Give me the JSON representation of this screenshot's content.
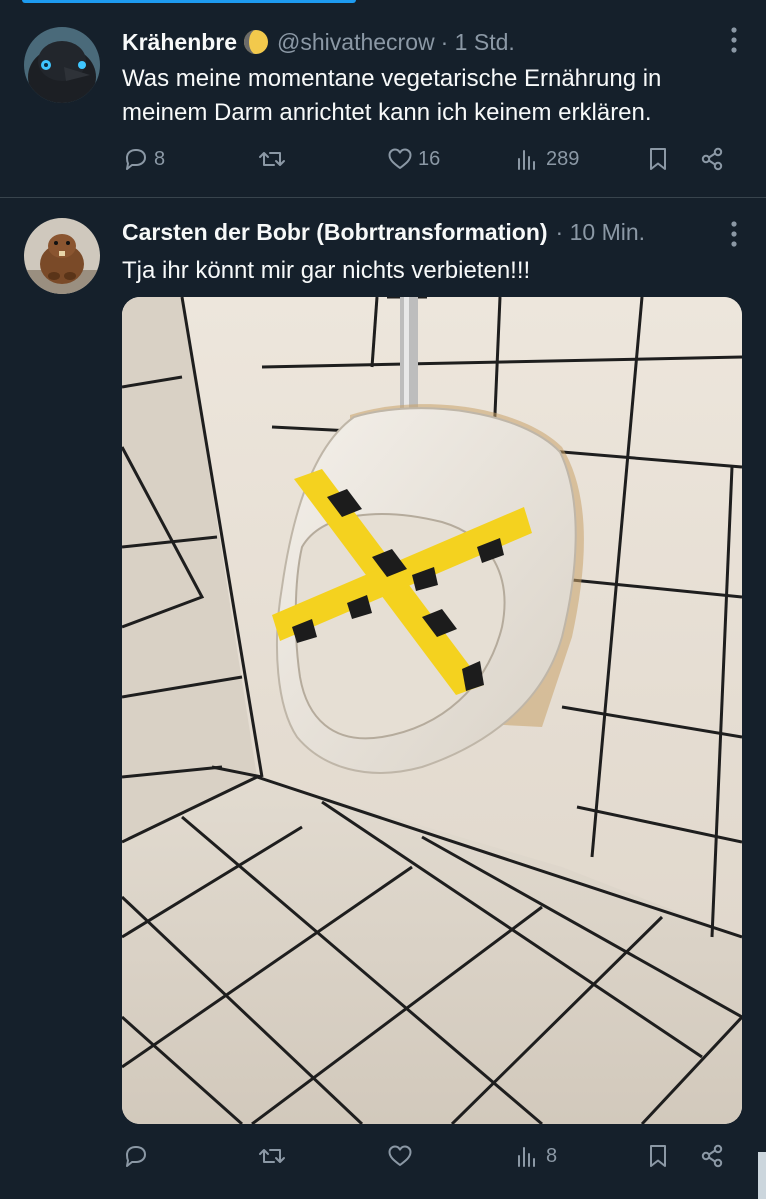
{
  "tweets": [
    {
      "display_name": "Krähenbre",
      "badge": "moon-emoji",
      "handle": "@shivathecrow",
      "time": "· 1 Std.",
      "text": "Was meine momentane vegetarische Ernährung in meinem Darm anrichtet kann ich keinem erklären.",
      "replies": "8",
      "retweets": "",
      "likes": "16",
      "views": "289"
    },
    {
      "display_name": "Carsten der Bobr (Bobrtransformation)",
      "time": "· 10 Min.",
      "text": "Tja ihr könnt mir gar nichts verbieten!!!",
      "replies": "",
      "retweets": "",
      "likes": "",
      "views": "8"
    }
  ],
  "colors": {
    "background": "#15202b",
    "text": "#f7f9f9",
    "muted": "#8b98a5",
    "divider": "#38444d",
    "accent": "#1d9bf0",
    "tape_yellow": "#f4d21f"
  }
}
